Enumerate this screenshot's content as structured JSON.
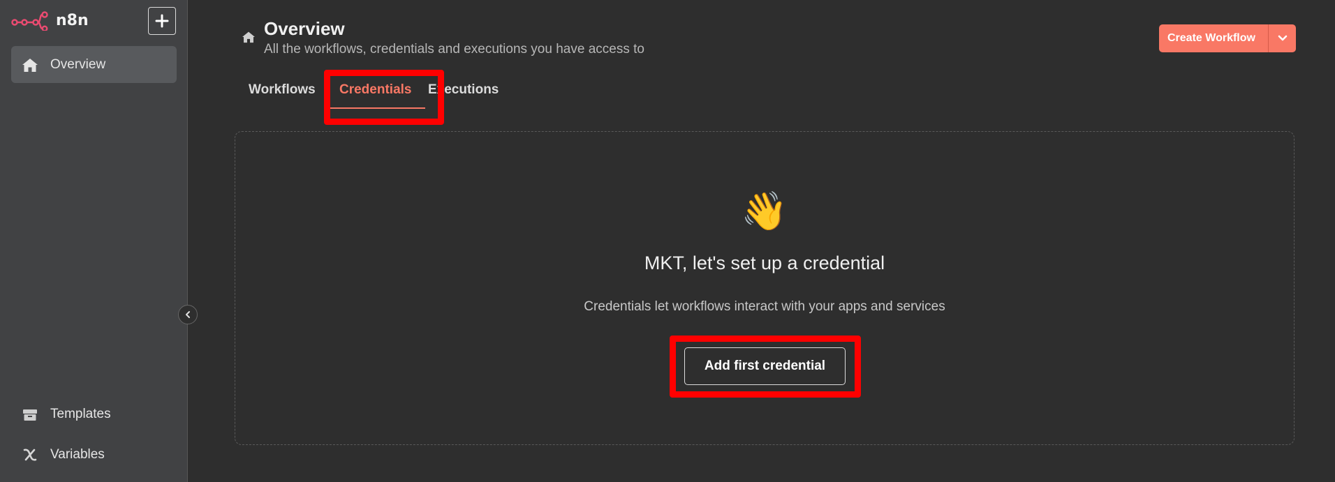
{
  "app": {
    "name": "n8n"
  },
  "sidebar": {
    "items": [
      {
        "label": "Overview",
        "icon": "home-icon"
      },
      {
        "label": "Templates",
        "icon": "box-icon"
      },
      {
        "label": "Variables",
        "icon": "variable-x-icon"
      }
    ]
  },
  "header": {
    "title": "Overview",
    "subtitle": "All the workflows, credentials and executions you have access to",
    "create_label": "Create Workflow"
  },
  "tabs": [
    {
      "label": "Workflows"
    },
    {
      "label": "Credentials",
      "active": true
    },
    {
      "label": "Executions"
    }
  ],
  "empty_state": {
    "emoji": "👋",
    "heading": "MKT, let's set up a credential",
    "description": "Credentials let workflows interact with your apps and services",
    "button_label": "Add first credential"
  },
  "colors": {
    "accent": "#f97865",
    "highlight": "#ff0000",
    "sidebar_bg": "#414244",
    "main_bg": "#2e2e2e"
  }
}
